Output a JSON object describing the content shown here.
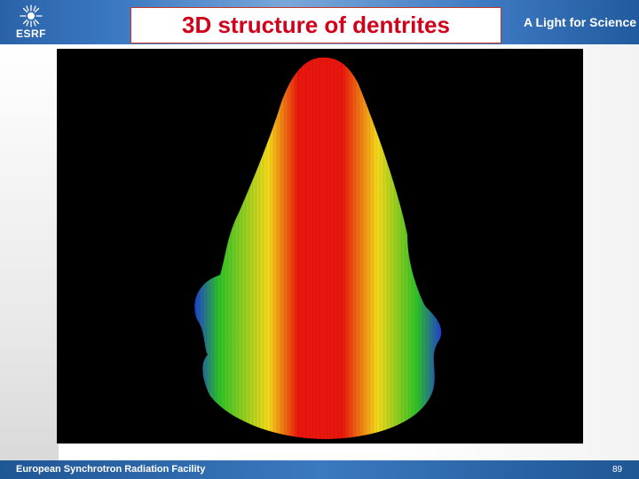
{
  "header": {
    "logo_text": "ESRF",
    "title": "3D structure of dentrites",
    "slogan": "A Light for Science"
  },
  "figure": {
    "icon": "dendrite-3d-rendering",
    "colors": {
      "core": "#e8160c",
      "mid": "#f4d81a",
      "outer": "#2ec126",
      "edge": "#1f3ed0",
      "background": "#000000"
    }
  },
  "footer": {
    "text": "European Synchrotron Radiation Facility",
    "page_number": "89"
  }
}
